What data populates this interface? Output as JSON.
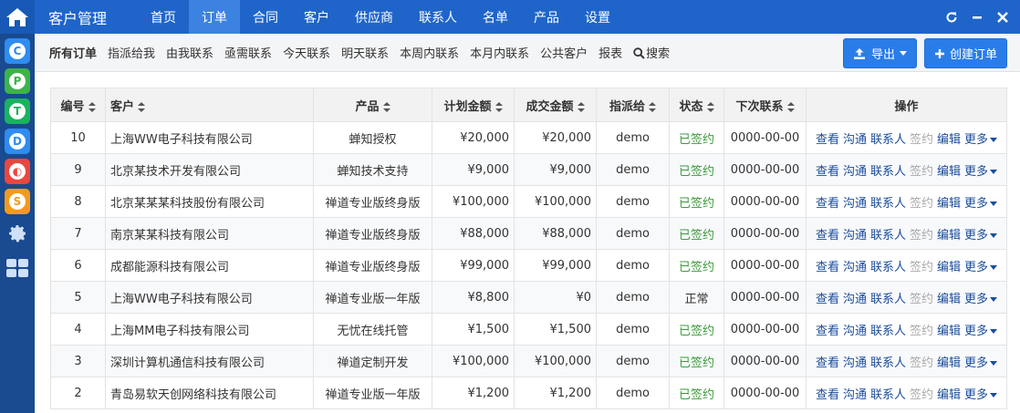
{
  "colors": {
    "topbar": "#1f65c9",
    "nav_active": "#3c82e0",
    "leftbar": "#1a4a8f",
    "signed": "#3c9b3c",
    "primary_button": "#2a7de9"
  },
  "leftbar": {
    "apps": [
      {
        "letter": "C",
        "color": "#2f8cf0"
      },
      {
        "letter": "P",
        "color": "#3db34a"
      },
      {
        "letter": "T",
        "color": "#19b35f"
      },
      {
        "letter": "D",
        "color": "#2f8cf0"
      },
      {
        "letter": "◐",
        "color": "#e9473f"
      },
      {
        "letter": "S",
        "color": "#f29a1f"
      }
    ],
    "icons": [
      "gear-icon",
      "grid-icon"
    ]
  },
  "topbar": {
    "brand": "客户管理",
    "nav": [
      "首页",
      "订单",
      "合同",
      "客户",
      "供应商",
      "联系人",
      "名单",
      "产品",
      "设置"
    ],
    "active_nav": "订单"
  },
  "subbar": {
    "filters": [
      "所有订单",
      "指派给我",
      "由我联系",
      "亟需联系",
      "今天联系",
      "明天联系",
      "本周内联系",
      "本月内联系",
      "公共客户",
      "报表",
      "搜索"
    ],
    "export_label": "导出",
    "create_label": "创建订单"
  },
  "table": {
    "headers": [
      "编号",
      "客户",
      "产品",
      "计划金额",
      "成交金额",
      "指派给",
      "状态",
      "下次联系",
      "操作"
    ],
    "rows": [
      {
        "id": "10",
        "customer": "上海WW电子科技有限公司",
        "product": "蝉知授权",
        "plan": "¥20,000",
        "deal": "¥20,000",
        "assignee": "demo",
        "status": "已签约",
        "next": "0000-00-00",
        "signed": true
      },
      {
        "id": "9",
        "customer": "北京某技术开发有限公司",
        "product": "蝉知技术支持",
        "plan": "¥9,000",
        "deal": "¥9,000",
        "assignee": "demo",
        "status": "已签约",
        "next": "0000-00-00",
        "signed": true
      },
      {
        "id": "8",
        "customer": "北京某某某科技股份有限公司",
        "product": "禅道专业版终身版",
        "plan": "¥100,000",
        "deal": "¥100,000",
        "assignee": "demo",
        "status": "已签约",
        "next": "0000-00-00",
        "signed": true
      },
      {
        "id": "7",
        "customer": "南京某某科技有限公司",
        "product": "禅道专业版终身版",
        "plan": "¥88,000",
        "deal": "¥88,000",
        "assignee": "demo",
        "status": "已签约",
        "next": "0000-00-00",
        "signed": true
      },
      {
        "id": "6",
        "customer": "成都能源科技有限公司",
        "product": "禅道专业版终身版",
        "plan": "¥99,000",
        "deal": "¥99,000",
        "assignee": "demo",
        "status": "已签约",
        "next": "0000-00-00",
        "signed": true
      },
      {
        "id": "5",
        "customer": "上海WW电子科技有限公司",
        "product": "禅道专业版一年版",
        "plan": "¥8,800",
        "deal": "¥0",
        "assignee": "demo",
        "status": "正常",
        "next": "0000-00-00",
        "signed": false
      },
      {
        "id": "4",
        "customer": "上海MM电子科技有限公司",
        "product": "无忧在线托管",
        "plan": "¥1,500",
        "deal": "¥1,500",
        "assignee": "demo",
        "status": "已签约",
        "next": "0000-00-00",
        "signed": true
      },
      {
        "id": "3",
        "customer": "深圳计算机通信科技有限公司",
        "product": "禅道定制开发",
        "plan": "¥100,000",
        "deal": "¥100,000",
        "assignee": "demo",
        "status": "已签约",
        "next": "0000-00-00",
        "signed": true
      },
      {
        "id": "2",
        "customer": "青岛易软天创网络科技有限公司",
        "product": "禅道专业版一年版",
        "plan": "¥1,200",
        "deal": "¥1,200",
        "assignee": "demo",
        "status": "已签约",
        "next": "0000-00-00",
        "signed": true
      }
    ],
    "actions": [
      {
        "label": "查看",
        "disabled": false
      },
      {
        "label": "沟通",
        "disabled": false
      },
      {
        "label": "联系人",
        "disabled": false
      },
      {
        "label": "签约",
        "disabled": true
      },
      {
        "label": "编辑",
        "disabled": false
      },
      {
        "label": "更多",
        "disabled": false
      }
    ]
  }
}
